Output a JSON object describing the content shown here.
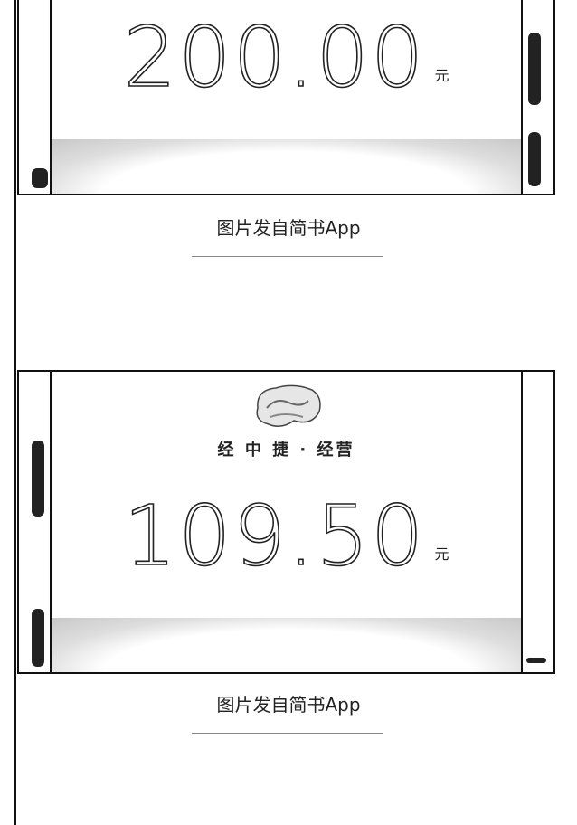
{
  "card1": {
    "amount": "200.00",
    "unit": "元"
  },
  "card2": {
    "merchant": "经 中 捷 ·      经营",
    "amount": "109.50",
    "unit": "元"
  },
  "caption1": "图片发自简书App",
  "caption2": "图片发自简书App",
  "colors": {
    "ink": "#222222",
    "border": "#111111",
    "background": "#ffffff"
  }
}
